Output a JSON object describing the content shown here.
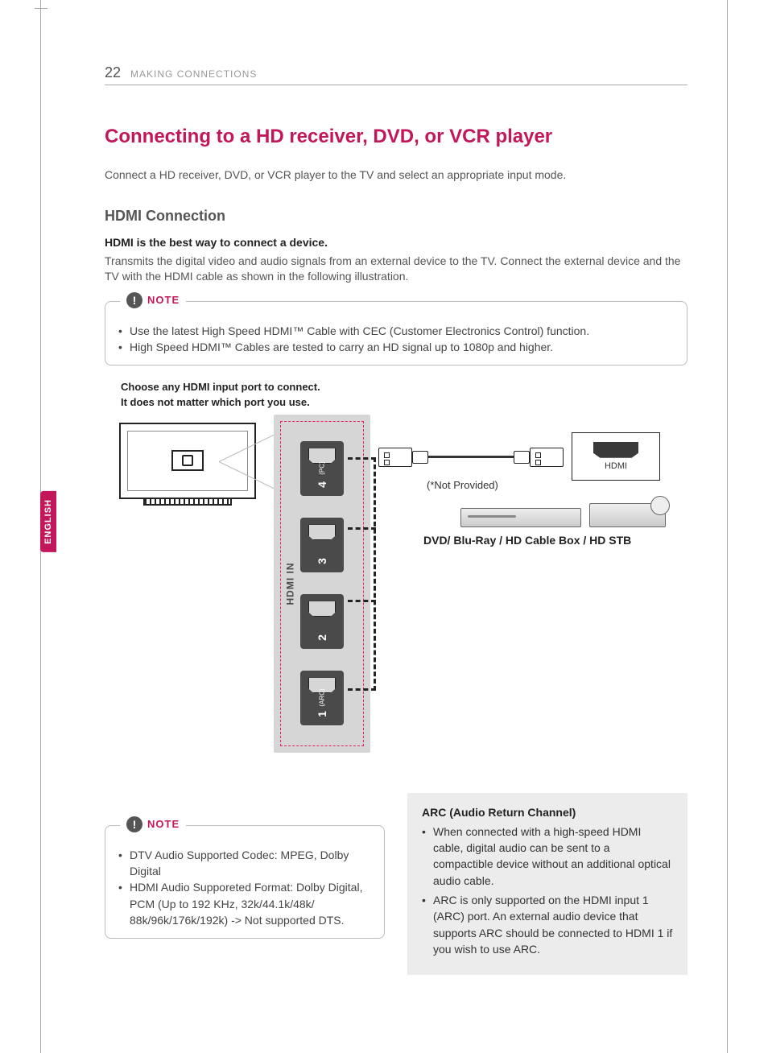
{
  "page": {
    "number": "22",
    "section": "MAKING CONNECTIONS",
    "language_tab": "ENGLISH"
  },
  "title": "Connecting to a HD receiver, DVD, or VCR player",
  "intro": "Connect a HD receiver, DVD, or VCR player to the TV and select an appropriate input mode.",
  "hdmi": {
    "heading": "HDMI Connection",
    "bold": "HDMI is the best way to connect a device.",
    "body": "Transmits the digital video and audio signals from an external device to the TV. Connect the external device and the TV with the HDMI cable as shown in the following illustration."
  },
  "note1": {
    "label": "NOTE",
    "items": [
      "Use the latest High Speed HDMI™ Cable with CEC (Customer Electronics Control) function.",
      "High Speed HDMI™ Cables are tested to carry an HD signal up to 1080p and higher."
    ]
  },
  "diagram": {
    "caption_line1": "Choose any HDMI input port to connect.",
    "caption_line2": "It does not matter which port you use.",
    "panel_label": "HDMI IN",
    "ports": {
      "p4_num": "4",
      "p4_sub": "(PC)",
      "p3_num": "3",
      "p2_num": "2",
      "p1_num": "1",
      "p1_sub": "(ARC)"
    },
    "not_provided": "(*Not Provided)",
    "remote_port_label": "HDMI",
    "device_caption": "DVD/ Blu-Ray / HD Cable Box / HD STB"
  },
  "note2": {
    "label": "NOTE",
    "items": [
      "DTV Audio Supported Codec: MPEG, Dolby Digital",
      "HDMI Audio Supporeted Format: Dolby Digital, PCM (Up to 192 KHz, 32k/44.1k/48k/ 88k/96k/176k/192k) -> Not supported DTS."
    ]
  },
  "arc": {
    "title": "ARC (Audio Return Channel)",
    "items": [
      "When connected with a high-speed HDMI cable, digital audio can be sent to a compactible device without an additional optical audio cable.",
      "ARC is only supported on the HDMI input 1 (ARC) port. An external audio device that supports ARC should be connected to HDMI 1 if you wish to use ARC."
    ]
  }
}
